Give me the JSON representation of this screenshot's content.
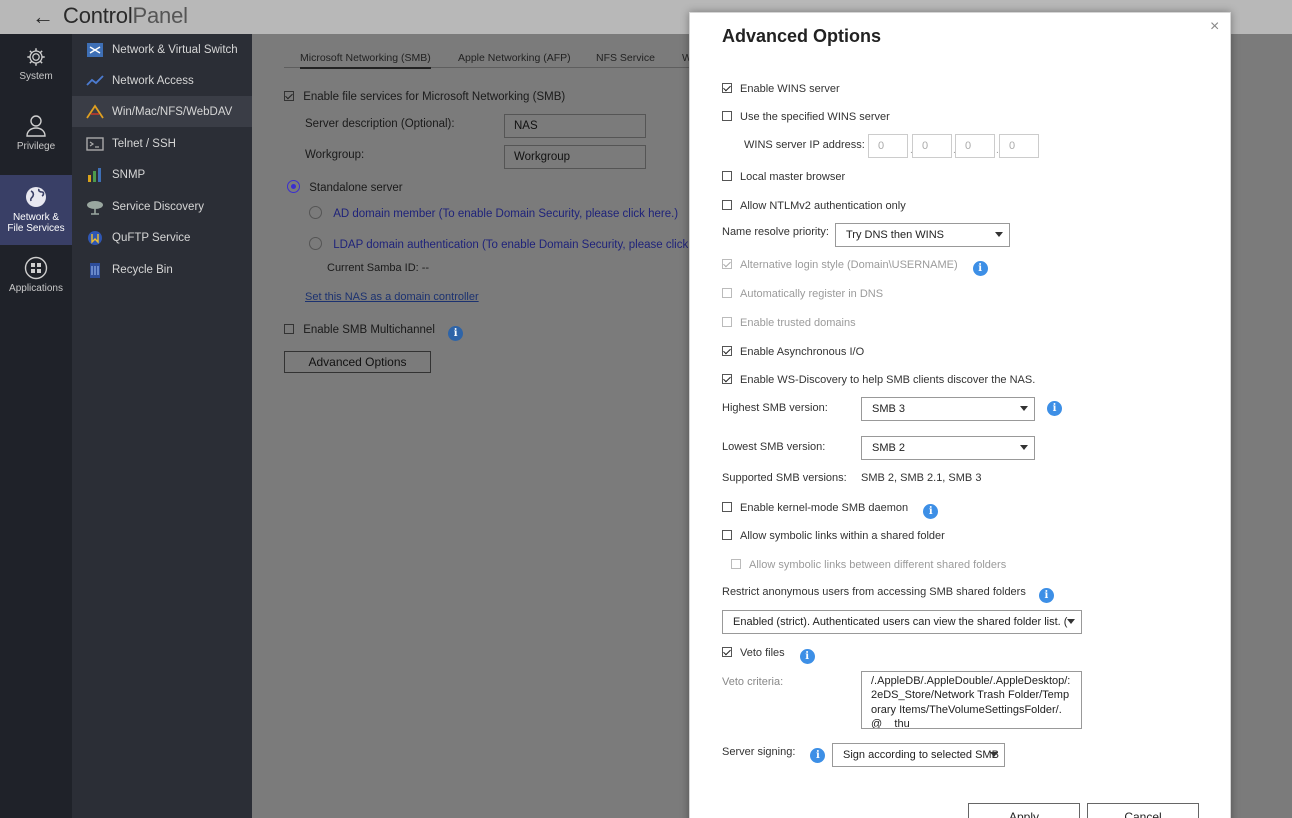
{
  "app": {
    "title_bold": "Control",
    "title_light": "Panel"
  },
  "rail": {
    "items": [
      {
        "label": "System",
        "icon": "gear-icon"
      },
      {
        "label": "Privilege",
        "icon": "user-icon"
      },
      {
        "label_line1": "Network &",
        "label_line2": "File Services",
        "icon": "globe-icon"
      },
      {
        "label": "Applications",
        "icon": "apps-icon"
      }
    ]
  },
  "subnav": {
    "items": [
      {
        "label": "Network & Virtual Switch",
        "icon": "switch-icon"
      },
      {
        "label": "Network Access",
        "icon": "network-icon"
      },
      {
        "label": "Win/Mac/NFS/WebDAV",
        "icon": "shares-icon"
      },
      {
        "label": "Telnet / SSH",
        "icon": "terminal-icon"
      },
      {
        "label": "SNMP",
        "icon": "snmp-icon"
      },
      {
        "label": "Service Discovery",
        "icon": "discovery-icon"
      },
      {
        "label": "QuFTP Service",
        "icon": "ftp-icon"
      },
      {
        "label": "Recycle Bin",
        "icon": "recycle-bin-icon"
      }
    ]
  },
  "main": {
    "tabs": [
      "Microsoft Networking (SMB)",
      "Apple Networking (AFP)",
      "NFS Service",
      "W"
    ],
    "enable_smb": "Enable file services for Microsoft Networking (SMB)",
    "server_desc_label": "Server description (Optional):",
    "server_desc_value": "NAS",
    "workgroup_label": "Workgroup:",
    "workgroup_value": "Workgroup",
    "standalone": "Standalone server",
    "ad_member": "AD domain member (To enable Domain Security, please click here.)",
    "ldap_auth": "LDAP domain authentication (To enable Domain Security, please click here.)",
    "samba_id": "Current Samba ID: --",
    "domain_controller_link": "Set this NAS as a domain controller",
    "smb_multichannel": "Enable SMB Multichannel",
    "advanced_button": "Advanced Options"
  },
  "modal": {
    "title": "Advanced Options",
    "close": "×",
    "wins_server": "Enable WINS server",
    "use_wins": "Use the specified WINS server",
    "wins_ip_label": "WINS server IP address:",
    "wins_ip": [
      "0",
      "0",
      "0",
      "0"
    ],
    "local_master": "Local master browser",
    "ntlmv2": "Allow NTLMv2 authentication only",
    "name_resolve_label": "Name resolve priority:",
    "name_resolve_value": "Try DNS then WINS",
    "alt_login": "Alternative login style (Domain\\USERNAME)",
    "auto_register": "Automatically register in DNS",
    "trusted_domains": "Enable trusted domains",
    "async_io": "Enable Asynchronous I/O",
    "ws_discovery": "Enable WS-Discovery to help SMB clients discover the NAS.",
    "highest_smb_label": "Highest SMB version:",
    "highest_smb_value": "SMB 3",
    "lowest_smb_label": "Lowest SMB version:",
    "lowest_smb_value": "SMB 2",
    "supported_label": "Supported SMB versions:",
    "supported_value": "SMB 2, SMB 2.1, SMB 3",
    "kernel_mode": "Enable kernel-mode SMB daemon",
    "symlinks": "Allow symbolic links within a shared folder",
    "symlinks_between": "Allow symbolic links between different shared folders",
    "restrict_anon": "Restrict anonymous users from accessing SMB shared folders",
    "restrict_value": "Enabled (strict). Authenticated users can view the shared folder list. (",
    "veto_files": "Veto files",
    "veto_criteria_label": "Veto criteria:",
    "veto_criteria_value": "/.AppleDB/.AppleDouble/.AppleDesktop/:2eDS_Store/Network Trash Folder/Temporary Items/TheVolumeSettingsFolder/.@__thu",
    "server_signing_label": "Server signing:",
    "server_signing_value": "Sign according to selected SMB",
    "apply": "Apply",
    "cancel": "Cancel",
    "info_glyph": "i"
  }
}
